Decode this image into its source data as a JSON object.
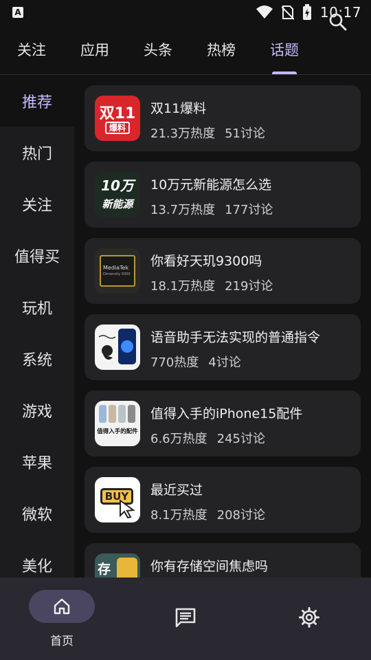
{
  "status_bar": {
    "time": "10:17",
    "app_icon_letter": "A",
    "icons": [
      "wifi-icon",
      "no-sim-icon",
      "battery-charging-icon"
    ]
  },
  "top_tabs": {
    "items": [
      {
        "label": "关注",
        "active": false
      },
      {
        "label": "应用",
        "active": false
      },
      {
        "label": "头条",
        "active": false
      },
      {
        "label": "热榜",
        "active": false
      },
      {
        "label": "话题",
        "active": true
      }
    ],
    "search_icon": "search-icon"
  },
  "side_nav": {
    "items": [
      {
        "label": "推荐",
        "active": true
      },
      {
        "label": "热门",
        "active": false
      },
      {
        "label": "关注",
        "active": false
      },
      {
        "label": "值得买",
        "active": false
      },
      {
        "label": "玩机",
        "active": false
      },
      {
        "label": "系统",
        "active": false
      },
      {
        "label": "游戏",
        "active": false
      },
      {
        "label": "苹果",
        "active": false
      },
      {
        "label": "微软",
        "active": false
      },
      {
        "label": "美化",
        "active": false
      }
    ]
  },
  "topics": [
    {
      "title": "双11爆料",
      "heat": "21.3万热度",
      "discussions": "51讨论",
      "thumb_text": "双11",
      "thumb_sub": "爆料"
    },
    {
      "title": "10万元新能源怎么选",
      "heat": "13.7万热度",
      "discussions": "177讨论",
      "thumb_text": "10万",
      "thumb_sub": "新能源"
    },
    {
      "title": "你看好天玑9300吗",
      "heat": "18.1万热度",
      "discussions": "219讨论",
      "thumb_text": "MediaTek",
      "thumb_sub": "Dimensity 9300"
    },
    {
      "title": "语音助手无法实现的普通指令",
      "heat": "770热度",
      "discussions": "4讨论"
    },
    {
      "title": "值得入手的iPhone15配件",
      "heat": "6.6万热度",
      "discussions": "245讨论",
      "thumb_text": "值得入手的配件"
    },
    {
      "title": "最近买过",
      "heat": "8.1万热度",
      "discussions": "208讨论",
      "thumb_text": "BUY"
    },
    {
      "title": "你有存储空间焦虑吗",
      "heat": "",
      "discussions": "",
      "thumb_text": "存"
    }
  ],
  "bottom_nav": {
    "items": [
      {
        "label": "首页",
        "icon": "home-icon",
        "active": true
      },
      {
        "label": "",
        "icon": "message-icon",
        "active": false
      },
      {
        "label": "",
        "icon": "settings-icon",
        "active": false
      }
    ]
  },
  "colors": {
    "accent": "#c6b9ff",
    "background": "#121212",
    "card": "#232326",
    "sidebar": "#1c1c1e",
    "bottom_bar": "#2a2830"
  }
}
